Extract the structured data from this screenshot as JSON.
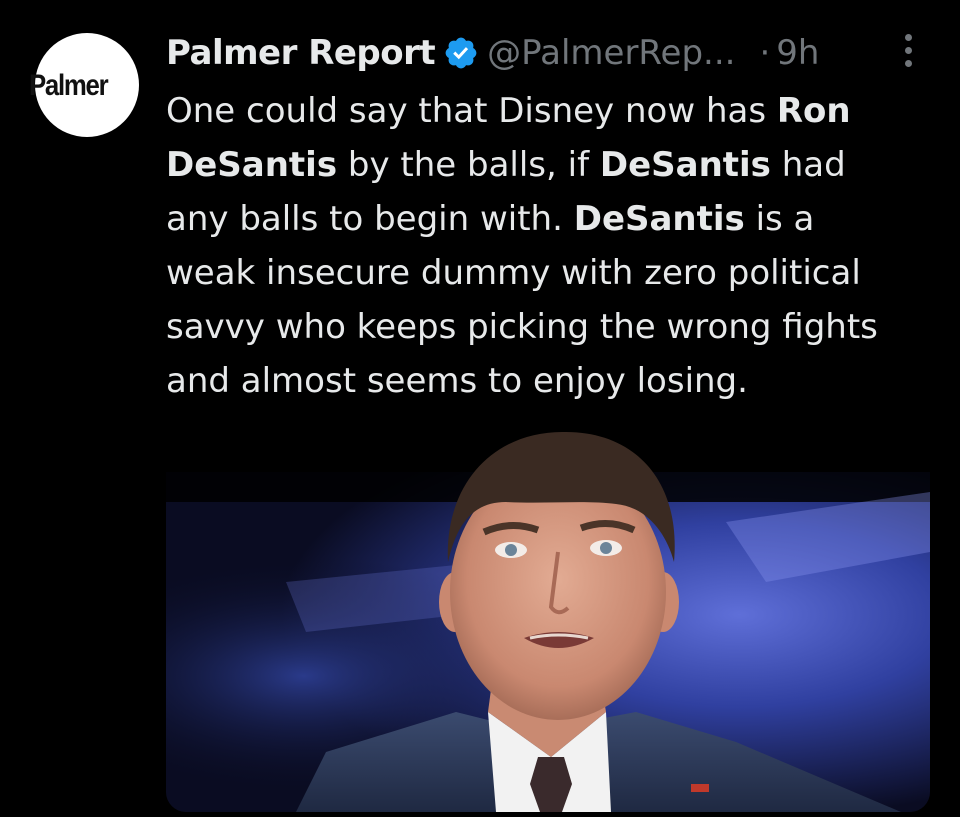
{
  "tweet": {
    "avatar_text": "Palmer",
    "display_name": "Palmer Report",
    "handle": "@PalmerRep...",
    "separator": "·",
    "time": "9h",
    "icons": {
      "verified": "verified-badge-icon",
      "more": "more-options-icon"
    },
    "colors": {
      "background": "#000000",
      "text": "#e7e9ea",
      "secondary": "#71767b",
      "verified": "#1d9bf0"
    },
    "text_lines": [
      [
        "One could say that Disney now has ",
        "Ron"
      ],
      [
        "DeSantis",
        " by the balls, if ",
        "DeSantis",
        " had"
      ],
      [
        "any balls to begin with. ",
        "DeSantis",
        " is a"
      ],
      [
        "weak insecure dummy with zero political"
      ],
      [
        "savvy who keeps picking the wrong fights"
      ],
      [
        "and almost seems to enjoy losing."
      ]
    ]
  }
}
